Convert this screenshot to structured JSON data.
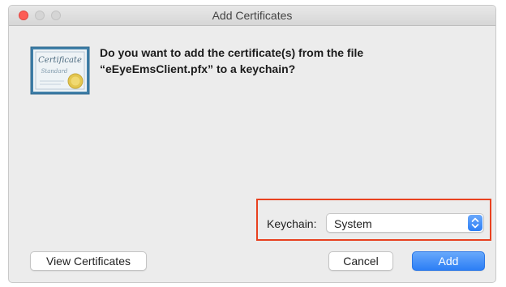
{
  "window": {
    "title": "Add Certificates"
  },
  "icon": {
    "name": "certificate-icon",
    "text_line1": "Certificate",
    "text_line2": "Standard"
  },
  "message": {
    "line1": "Do you want to add the certificate(s) from the file",
    "line2": "“eEyeEmsClient.pfx” to a keychain?"
  },
  "keychain": {
    "label": "Keychain:",
    "selected": "System"
  },
  "buttons": {
    "view_certificates": "View Certificates",
    "cancel": "Cancel",
    "add": "Add"
  },
  "colors": {
    "highlight_border": "#e8411f",
    "primary_button": "#2c7ef5",
    "close_button": "#fd5d56"
  }
}
